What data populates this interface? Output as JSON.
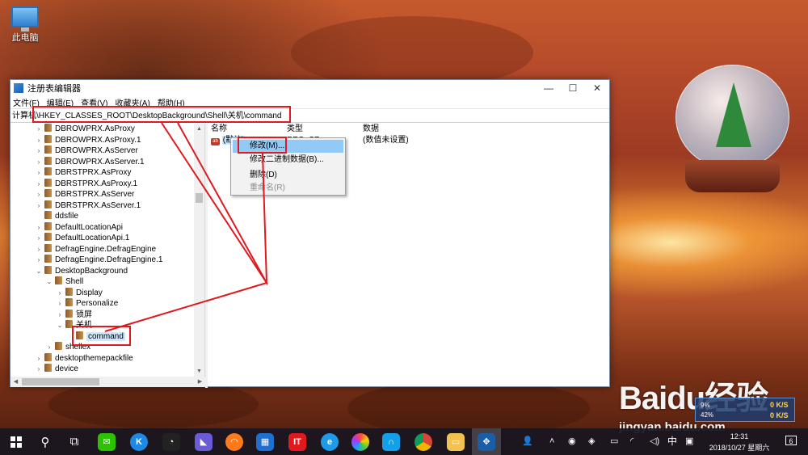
{
  "desktop": {
    "icon_label": "此电脑"
  },
  "window": {
    "title": "注册表编辑器",
    "controls": {
      "minimize": "—",
      "maximize": "☐",
      "close": "✕"
    },
    "menu": [
      "文件(F)",
      "编辑(E)",
      "查看(V)",
      "收藏夹(A)",
      "帮助(H)"
    ],
    "address": "计算机\\HKEY_CLASSES_ROOT\\DesktopBackground\\Shell\\关机\\command"
  },
  "tree": [
    {
      "label": "DBROWPRX.AsProxy",
      "depth": 0,
      "arrow": "›"
    },
    {
      "label": "DBROWPRX.AsProxy.1",
      "depth": 0,
      "arrow": "›"
    },
    {
      "label": "DBROWPRX.AsServer",
      "depth": 0,
      "arrow": "›"
    },
    {
      "label": "DBROWPRX.AsServer.1",
      "depth": 0,
      "arrow": "›"
    },
    {
      "label": "DBRSTPRX.AsProxy",
      "depth": 0,
      "arrow": "›"
    },
    {
      "label": "DBRSTPRX.AsProxy.1",
      "depth": 0,
      "arrow": "›"
    },
    {
      "label": "DBRSTPRX.AsServer",
      "depth": 0,
      "arrow": "›"
    },
    {
      "label": "DBRSTPRX.AsServer.1",
      "depth": 0,
      "arrow": "›"
    },
    {
      "label": "ddsfile",
      "depth": 0,
      "arrow": ""
    },
    {
      "label": "DefaultLocationApi",
      "depth": 0,
      "arrow": "›"
    },
    {
      "label": "DefaultLocationApi.1",
      "depth": 0,
      "arrow": "›"
    },
    {
      "label": "DefragEngine.DefragEngine",
      "depth": 0,
      "arrow": "›"
    },
    {
      "label": "DefragEngine.DefragEngine.1",
      "depth": 0,
      "arrow": "›"
    },
    {
      "label": "DesktopBackground",
      "depth": 0,
      "arrow": "⌄"
    },
    {
      "label": "Shell",
      "depth": 1,
      "arrow": "⌄"
    },
    {
      "label": "Display",
      "depth": 2,
      "arrow": "›"
    },
    {
      "label": "Personalize",
      "depth": 2,
      "arrow": "›"
    },
    {
      "label": "锁屏",
      "depth": 2,
      "arrow": "›"
    },
    {
      "label": "关机",
      "depth": 2,
      "arrow": "⌄"
    },
    {
      "label": "command",
      "depth": 3,
      "arrow": "",
      "selected": true
    },
    {
      "label": "shellex",
      "depth": 1,
      "arrow": "›"
    },
    {
      "label": "desktopthemepackfile",
      "depth": 0,
      "arrow": "›"
    },
    {
      "label": "device",
      "depth": 0,
      "arrow": "›"
    }
  ],
  "list": {
    "headers": {
      "name": "名称",
      "type": "类型",
      "data": "数据"
    },
    "row": {
      "name": "(默认)",
      "type": "REG_SZ",
      "data": "(数值未设置)"
    }
  },
  "context_menu": {
    "items": [
      {
        "label": "修改(M)...",
        "highlighted": true,
        "disabled": false
      },
      {
        "label": "修改二进制数据(B)...",
        "highlighted": false,
        "disabled": false
      },
      {
        "label": "删除(D)",
        "highlighted": false,
        "disabled": false
      },
      {
        "label": "重命名(R)",
        "highlighted": false,
        "disabled": true
      }
    ]
  },
  "watermark": {
    "brand": "Baidu经验",
    "url": "jingyan.baidu.com"
  },
  "net_meter": {
    "up_pct": "9%",
    "down_pct": "42%",
    "up_speed": "0 K/S",
    "down_speed": "0 K/S"
  },
  "taskbar": {
    "start_icon": "windows-logo",
    "tray_ime": "中",
    "clock_time": "12:31",
    "clock_date": "2018/10/27 星期六",
    "notifications_count": "6"
  },
  "colors": {
    "annotation": "#e0191f",
    "highlight": "#91c9f7",
    "selection": "#cce8ff"
  }
}
